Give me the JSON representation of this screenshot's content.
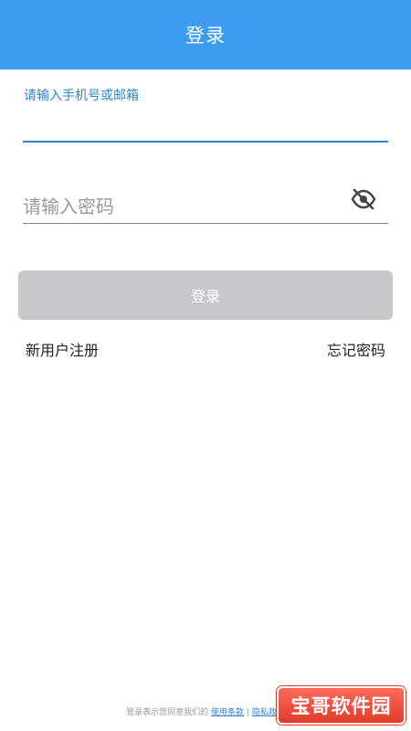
{
  "header": {
    "title": "登录"
  },
  "account_field": {
    "label": "请输入手机号或邮箱"
  },
  "password_field": {
    "placeholder": "请输入密码",
    "toggle_icon": "eye-off-icon"
  },
  "login_button": {
    "label": "登录"
  },
  "links": {
    "register": "新用户注册",
    "forgot": "忘记密码"
  },
  "footer": {
    "prefix": "登录表示您同意我们的",
    "terms": "使用条款",
    "separator": "|",
    "privacy": "隐私政策"
  },
  "watermark": {
    "text": "宝哥软件园"
  },
  "colors": {
    "header_bg": "#3d9cf2",
    "accent": "#2f86c9",
    "button_disabled": "#c8c8cb"
  }
}
